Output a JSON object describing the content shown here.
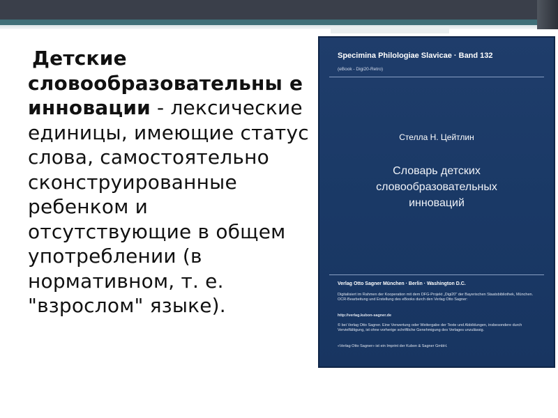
{
  "definition": {
    "term": "Детские словообразовательны е инновации",
    "text": " - лексические единицы, имеющие статус слова, самостоятельно сконструированные ребенком и отсутствующие в общем употреблении (в нормативном, т. е. \"взрослом\" языке)."
  },
  "cover": {
    "series": "Specimina Philologiae Slavicae · Band 132",
    "ebook": "(eBook - Digi20-Retro)",
    "author": "Стелла Н. Цейтлин",
    "title_lines": [
      "Словарь детских",
      "словообразовательных",
      "инноваций"
    ],
    "publisher": "Verlag Otto Sagner   München · Berlin · Washington D.C.",
    "note1": "Digitalisiert im Rahmen der Kooperation mit dem DFG-Projekt „Digi20\" der Bayerischen Staatsbibliothek, München. OCR-Bearbeitung und Erstellung des eBooks durch den Verlag Otto Sagner:",
    "url": "http://verlag.kubon-sagner.de",
    "note3": "© bei Verlag Otto Sagner. Eine Verwertung oder Weitergabe der Texte und Abbildungen, insbesondere durch Vervielfältigung, ist ohne vorherige schriftliche Genehmigung des Verlages unzulässig.",
    "note4": "«Verlag Otto Sagner» ist ein Imprint der Kubon & Sagner GmbH."
  }
}
